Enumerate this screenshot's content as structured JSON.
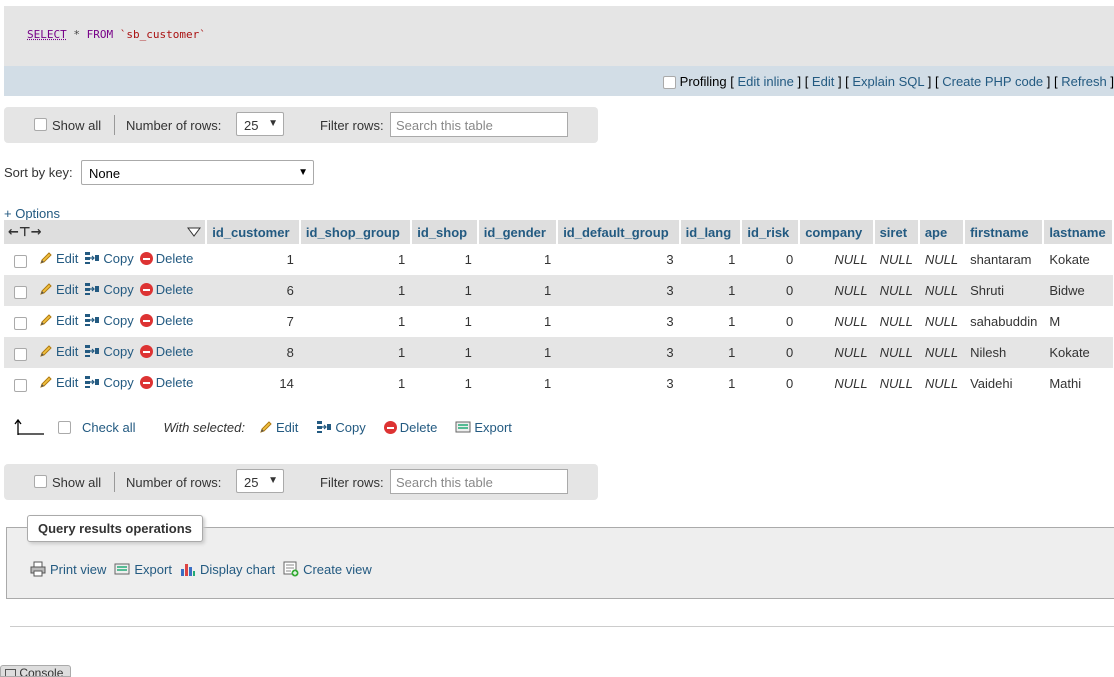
{
  "query": {
    "select": "SELECT",
    "star": "*",
    "from": "FROM",
    "table": "`sb_customer`"
  },
  "profiling": {
    "label": "Profiling",
    "edit_inline": "Edit inline",
    "edit": "Edit",
    "explain": "Explain SQL",
    "create_php": "Create PHP code",
    "refresh": "Refresh"
  },
  "nav": {
    "show_all": "Show all",
    "number_of_rows": "Number of rows:",
    "rows_value": "25",
    "filter_rows": "Filter rows:",
    "search_placeholder": "Search this table"
  },
  "sort": {
    "label": "Sort by key:",
    "value": "None"
  },
  "options_label": "+ Options",
  "columns": [
    "id_customer",
    "id_shop_group",
    "id_shop",
    "id_gender",
    "id_default_group",
    "id_lang",
    "id_risk",
    "company",
    "siret",
    "ape",
    "firstname",
    "lastname"
  ],
  "row_actions": {
    "edit": "Edit",
    "copy": "Copy",
    "delete": "Delete"
  },
  "rows": [
    [
      "1",
      "1",
      "1",
      "1",
      "3",
      "1",
      "0",
      "NULL",
      "NULL",
      "NULL",
      "shantaram",
      "Kokate"
    ],
    [
      "6",
      "1",
      "1",
      "1",
      "3",
      "1",
      "0",
      "NULL",
      "NULL",
      "NULL",
      "Shruti",
      "Bidwe"
    ],
    [
      "7",
      "1",
      "1",
      "1",
      "3",
      "1",
      "0",
      "NULL",
      "NULL",
      "NULL",
      "sahabuddin",
      "M"
    ],
    [
      "8",
      "1",
      "1",
      "1",
      "3",
      "1",
      "0",
      "NULL",
      "NULL",
      "NULL",
      "Nilesh",
      "Kokate"
    ],
    [
      "14",
      "1",
      "1",
      "1",
      "3",
      "1",
      "0",
      "NULL",
      "NULL",
      "NULL",
      "Vaidehi",
      "Mathi"
    ]
  ],
  "bulk": {
    "check_all": "Check all",
    "with_selected": "With selected:",
    "edit": "Edit",
    "copy": "Copy",
    "delete": "Delete",
    "export": "Export"
  },
  "operations": {
    "legend": "Query results operations",
    "print_view": "Print view",
    "export": "Export",
    "display_chart": "Display chart",
    "create_view": "Create view"
  },
  "console_label": "Console"
}
